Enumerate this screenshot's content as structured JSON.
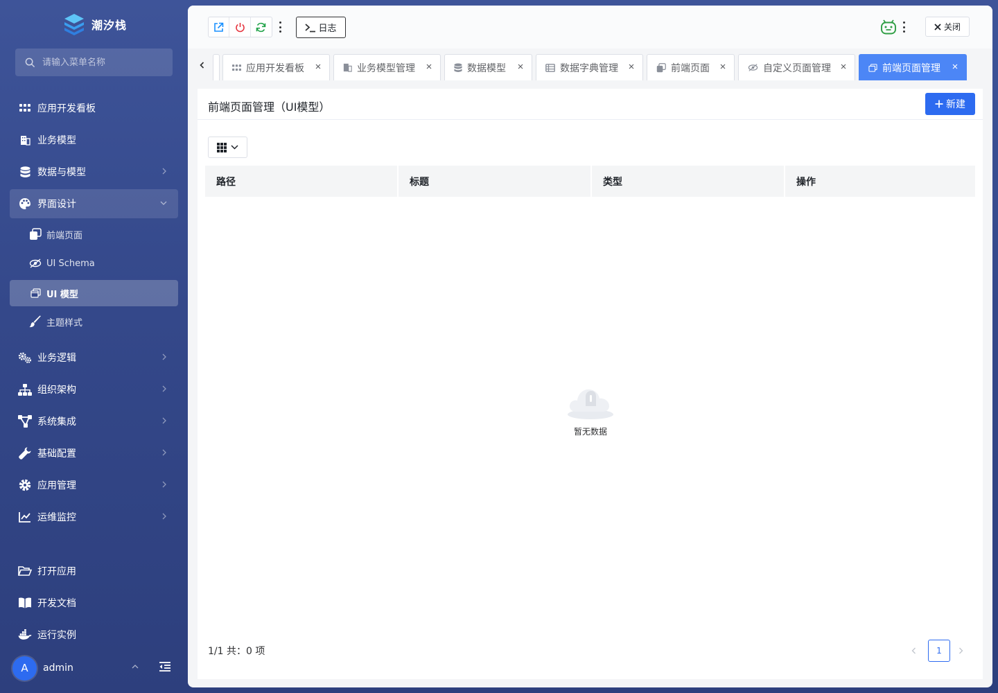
{
  "brand": {
    "name": "潮汐栈"
  },
  "search": {
    "placeholder": "请输入菜单名称"
  },
  "sidebar": {
    "items": [
      {
        "label": "应用开发看板",
        "icon": "grid-dots-icon"
      },
      {
        "label": "业务模型",
        "icon": "building-icon"
      },
      {
        "label": "数据与模型",
        "icon": "database-icon",
        "expandable": true
      },
      {
        "label": "界面设计",
        "icon": "palette-icon",
        "expandable": true,
        "open": true
      },
      {
        "label": "业务逻辑",
        "icon": "cogs-icon",
        "expandable": true
      },
      {
        "label": "组织架构",
        "icon": "sitemap-icon",
        "expandable": true
      },
      {
        "label": "系统集成",
        "icon": "connections-icon",
        "expandable": true
      },
      {
        "label": "基础配置",
        "icon": "wrench-icon",
        "expandable": true
      },
      {
        "label": "应用管理",
        "icon": "gear-icon",
        "expandable": true
      },
      {
        "label": "运维监控",
        "icon": "line-chart-icon",
        "expandable": true
      }
    ],
    "sub_items": [
      {
        "label": "前端页面",
        "icon": "pages-icon"
      },
      {
        "label": "UI Schema",
        "icon": "eye-scan-icon"
      },
      {
        "label": "UI 模型",
        "icon": "window-icon",
        "active": true
      },
      {
        "label": "主题样式",
        "icon": "brush-icon"
      }
    ],
    "bottom_items": [
      {
        "label": "打开应用",
        "icon": "folder-open-icon"
      },
      {
        "label": "开发文档",
        "icon": "book-icon"
      },
      {
        "label": "运行实例",
        "icon": "docker-icon"
      }
    ]
  },
  "user": {
    "avatar_letter": "A",
    "name": "admin"
  },
  "toolbar": {
    "log_label": "日志",
    "close_label": "关闭"
  },
  "tabs": [
    {
      "label": "应用开发看板",
      "icon": "grid-dots-icon"
    },
    {
      "label": "业务模型管理",
      "icon": "building-icon"
    },
    {
      "label": "数据模型",
      "icon": "database-icon"
    },
    {
      "label": "数据字典管理",
      "icon": "table-icon"
    },
    {
      "label": "前端页面",
      "icon": "pages-icon"
    },
    {
      "label": "自定义页面管理",
      "icon": "eye-scan-icon"
    },
    {
      "label": "前端页面管理",
      "icon": "window-icon",
      "active": true
    }
  ],
  "page": {
    "title": "前端页面管理（UI模型）",
    "new_button": "新建",
    "columns": [
      "路径",
      "标题",
      "类型",
      "操作"
    ],
    "empty_text": "暂无数据",
    "footer": "1/1 共：0 项",
    "current_page": "1"
  },
  "colors": {
    "primary": "#2d6bf0",
    "tab_active": "#4c86f6",
    "sidebar": "#34488a"
  }
}
